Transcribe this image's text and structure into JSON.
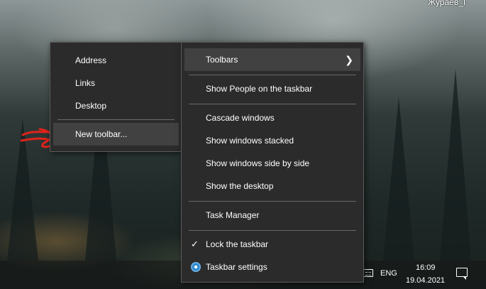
{
  "desktop": {
    "user_label": "Жураев_I"
  },
  "submenu": {
    "items": [
      {
        "label": "Address"
      },
      {
        "label": "Links"
      },
      {
        "label": "Desktop"
      },
      {
        "label": "New toolbar..."
      }
    ]
  },
  "main_menu": {
    "toolbars": "Toolbars",
    "show_people": "Show People on the taskbar",
    "cascade": "Cascade windows",
    "stacked": "Show windows stacked",
    "side_by_side": "Show windows side by side",
    "show_desktop": "Show the desktop",
    "task_manager": "Task Manager",
    "lock_taskbar": "Lock the taskbar",
    "taskbar_settings": "Taskbar settings"
  },
  "tray": {
    "language": "ENG",
    "time": "16:09",
    "date": "19.04.2021"
  },
  "colors": {
    "menu_bg": "#2b2b2b",
    "highlight": "#414141",
    "annotation": "#e0241b"
  },
  "icons": [
    "chevron-right-icon",
    "checkmark-icon",
    "gear-icon",
    "keyboard-icon",
    "notification-icon"
  ]
}
